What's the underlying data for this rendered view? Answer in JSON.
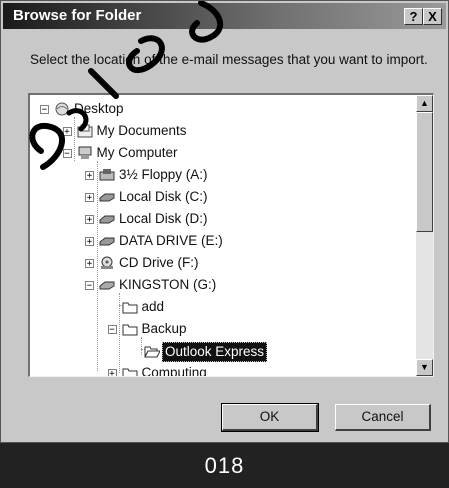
{
  "dialog": {
    "title": "Browse for Folder",
    "help_button": "?",
    "close_button": "X",
    "prompt": "Select the location of the e-mail messages that you want to import.",
    "ok_label": "OK",
    "cancel_label": "Cancel",
    "scroll_up_glyph": "▲",
    "scroll_down_glyph": "▼"
  },
  "tree": {
    "items": [
      {
        "label": "Desktop",
        "icon": "desktop-icon",
        "expander": "−"
      },
      {
        "label": "My Documents",
        "icon": "documents-folder-icon",
        "expander": "+"
      },
      {
        "label": "My Computer",
        "icon": "computer-icon",
        "expander": "−"
      },
      {
        "label": "3½ Floppy (A:)",
        "icon": "floppy-drive-icon",
        "expander": "+"
      },
      {
        "label": "Local Disk (C:)",
        "icon": "hard-disk-icon",
        "expander": "+"
      },
      {
        "label": "Local Disk (D:)",
        "icon": "hard-disk-icon",
        "expander": "+"
      },
      {
        "label": "DATA DRIVE (E:)",
        "icon": "hard-disk-icon",
        "expander": "+"
      },
      {
        "label": "CD Drive (F:)",
        "icon": "cd-drive-icon",
        "expander": "+"
      },
      {
        "label": "KINGSTON (G:)",
        "icon": "removable-drive-icon",
        "expander": "−"
      },
      {
        "label": "add",
        "icon": "folder-icon",
        "expander": ""
      },
      {
        "label": "Backup",
        "icon": "folder-icon",
        "expander": "−"
      },
      {
        "label": "Outlook Express",
        "icon": "folder-open-icon",
        "expander": "",
        "selected": true
      },
      {
        "label": "Computing",
        "icon": "folder-icon",
        "expander": "+"
      }
    ]
  },
  "caption": "018",
  "watermark_text": "52 ذهبا"
}
